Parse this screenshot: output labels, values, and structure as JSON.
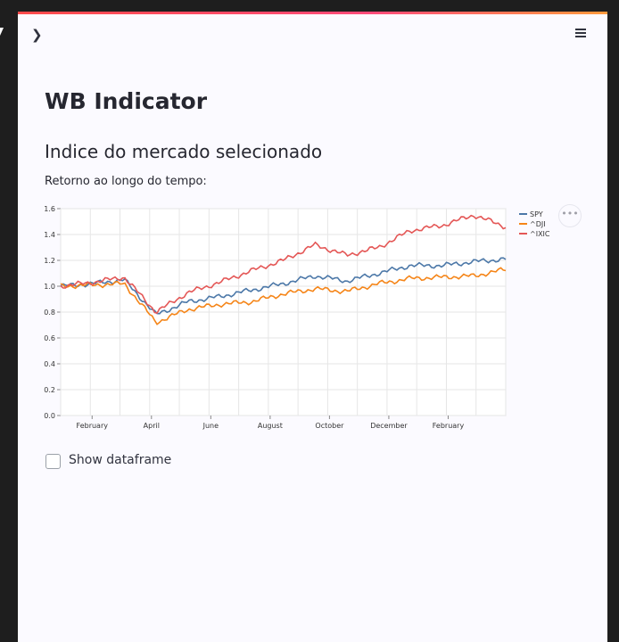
{
  "app": {
    "title": "WB Indicator",
    "subtitle": "Indice do mercado selecionado",
    "caption": "Retorno ao longo do tempo:",
    "checkbox_label": "Show dataframe",
    "accent_gradient": [
      "#ff4b4b",
      "#ff9a3c"
    ]
  },
  "icons": {
    "sidebar_toggle": "chevron-right-icon",
    "menu": "hamburger-menu-icon",
    "chart_actions": "more-horizontal-icon"
  },
  "chart_data": {
    "type": "line",
    "title": "",
    "xlabel": "",
    "ylabel": "",
    "ylim": [
      0,
      1.6
    ],
    "yticks": [
      "0.0",
      "0.2",
      "0.4",
      "0.6",
      "0.8",
      "1.0",
      "1.2",
      "1.4",
      "1.6"
    ],
    "xticks": [
      "February",
      "April",
      "June",
      "August",
      "October",
      "December",
      "February"
    ],
    "grid": true,
    "legend_position": "right",
    "x": [
      "2020-01",
      "2020-02",
      "2020-03",
      "2020-04",
      "2020-05",
      "2020-06",
      "2020-07",
      "2020-08",
      "2020-09",
      "2020-10",
      "2020-11",
      "2020-12",
      "2021-01",
      "2021-02",
      "2021-03"
    ],
    "series": [
      {
        "name": "SPY",
        "color": "#4c78a8",
        "values": [
          1.0,
          1.02,
          1.05,
          0.78,
          0.88,
          0.92,
          0.97,
          1.02,
          1.08,
          1.04,
          1.1,
          1.16,
          1.16,
          1.19,
          1.21
        ]
      },
      {
        "name": "^DJI",
        "color": "#f58518",
        "values": [
          1.0,
          1.01,
          1.02,
          0.72,
          0.82,
          0.86,
          0.88,
          0.94,
          0.98,
          0.96,
          1.02,
          1.06,
          1.07,
          1.08,
          1.13
        ]
      },
      {
        "name": "^IXIC",
        "color": "#e45756",
        "values": [
          1.0,
          1.03,
          1.07,
          0.8,
          0.95,
          1.03,
          1.12,
          1.2,
          1.32,
          1.24,
          1.3,
          1.43,
          1.47,
          1.55,
          1.46
        ]
      }
    ]
  }
}
